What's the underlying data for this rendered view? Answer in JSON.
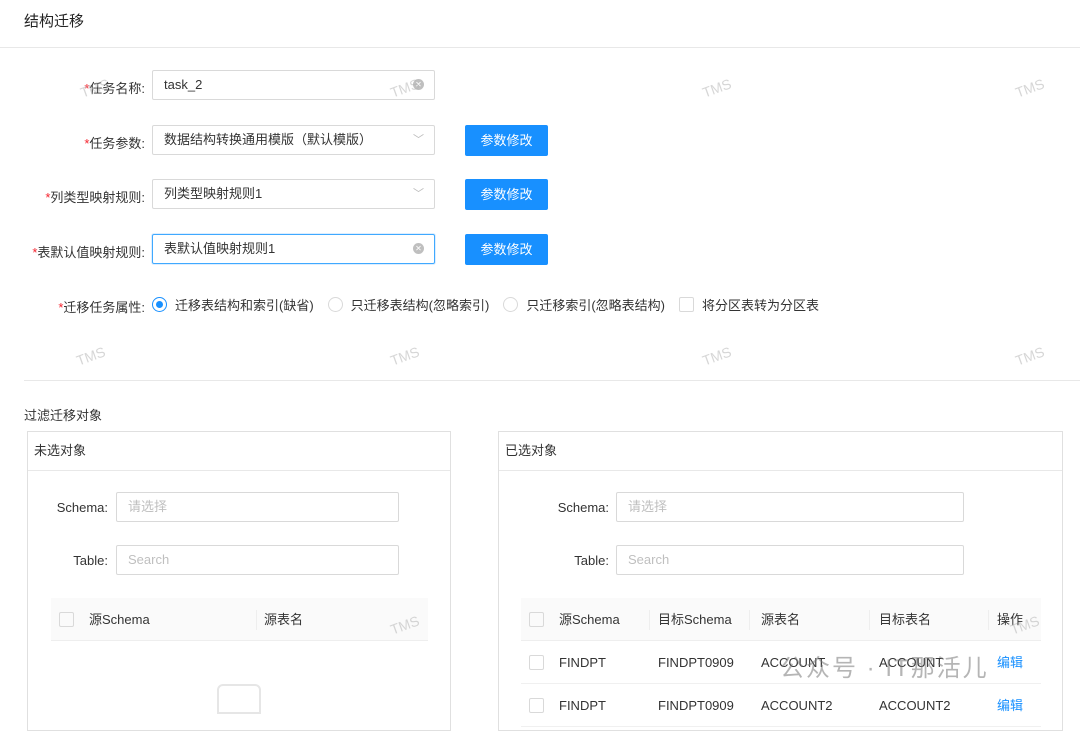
{
  "page_title": "结构迁移",
  "form": {
    "task_name": {
      "label": "任务名称:",
      "value": "task_2"
    },
    "task_params": {
      "label": "任务参数:",
      "value": "数据结构转换通用模版（默认模版）",
      "button": "参数修改"
    },
    "column_mapping": {
      "label": "列类型映射规则:",
      "value": "列类型映射规则1",
      "button": "参数修改"
    },
    "default_mapping": {
      "label": "表默认值映射规则:",
      "value": "表默认值映射规则1",
      "button": "参数修改"
    },
    "attributes": {
      "label": "迁移任务属性:",
      "options": [
        "迁移表结构和索引(缺省)",
        "只迁移表结构(忽略索引)",
        "只迁移索引(忽略表结构)"
      ],
      "selected": 0,
      "checkbox": "将分区表转为分区表"
    }
  },
  "filter": {
    "title": "过滤迁移对象",
    "left": {
      "title": "未选对象",
      "schema_label": "Schema:",
      "schema_placeholder": "请选择",
      "table_label": "Table:",
      "table_placeholder": "Search",
      "columns": [
        "源Schema",
        "源表名"
      ]
    },
    "right": {
      "title": "已选对象",
      "schema_label": "Schema:",
      "schema_placeholder": "请选择",
      "table_label": "Table:",
      "table_placeholder": "Search",
      "columns": [
        "源Schema",
        "目标Schema",
        "源表名",
        "目标表名",
        "操作"
      ],
      "rows": [
        {
          "src_schema": "FINDPT",
          "dst_schema": "FINDPT0909",
          "src_table": "ACCOUNT",
          "dst_table": "ACCOUNT",
          "action": "编辑"
        },
        {
          "src_schema": "FINDPT",
          "dst_schema": "FINDPT0909",
          "src_table": "ACCOUNT2",
          "dst_table": "ACCOUNT2",
          "action": "编辑"
        }
      ]
    }
  },
  "watermark": "TMS",
  "overlay_watermark": "公众号 · IT那活儿"
}
